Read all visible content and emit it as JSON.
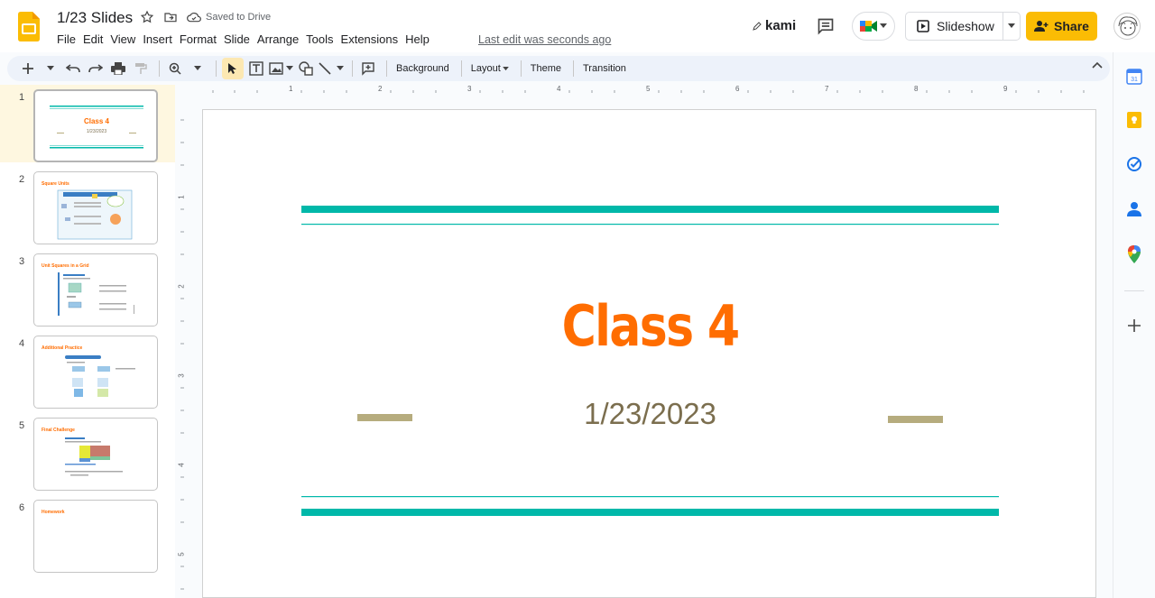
{
  "header": {
    "title": "1/23 Slides",
    "saved_status": "Saved to Drive",
    "last_edit": "Last edit was seconds ago",
    "menu": [
      "File",
      "Edit",
      "View",
      "Insert",
      "Format",
      "Slide",
      "Arrange",
      "Tools",
      "Extensions",
      "Help"
    ],
    "kami_label": "kami",
    "slideshow_label": "Slideshow",
    "share_label": "Share"
  },
  "toolbar": {
    "background_label": "Background",
    "layout_label": "Layout",
    "theme_label": "Theme",
    "transition_label": "Transition"
  },
  "slides": [
    {
      "number": "1",
      "title": "Class 4",
      "subtitle": "1/23/2023",
      "selected": true
    },
    {
      "number": "2",
      "title": "Square Units"
    },
    {
      "number": "3",
      "title": "Unit Squares in a Grid"
    },
    {
      "number": "4",
      "title": "Additional Practice"
    },
    {
      "number": "5",
      "title": "Final Challenge"
    },
    {
      "number": "6",
      "title": "Homework"
    }
  ],
  "current_slide": {
    "title": "Class 4",
    "date": "1/23/2023"
  },
  "ruler": {
    "horizontal": [
      "1",
      "2",
      "3",
      "4",
      "5",
      "6",
      "7",
      "8",
      "9"
    ],
    "vertical": [
      "1",
      "2",
      "3",
      "4",
      "5"
    ]
  },
  "colors": {
    "title_orange": "#ff6d01",
    "teal": "#00b8a9",
    "tan": "#b6ac7e",
    "share_yellow": "#fbbc04"
  }
}
